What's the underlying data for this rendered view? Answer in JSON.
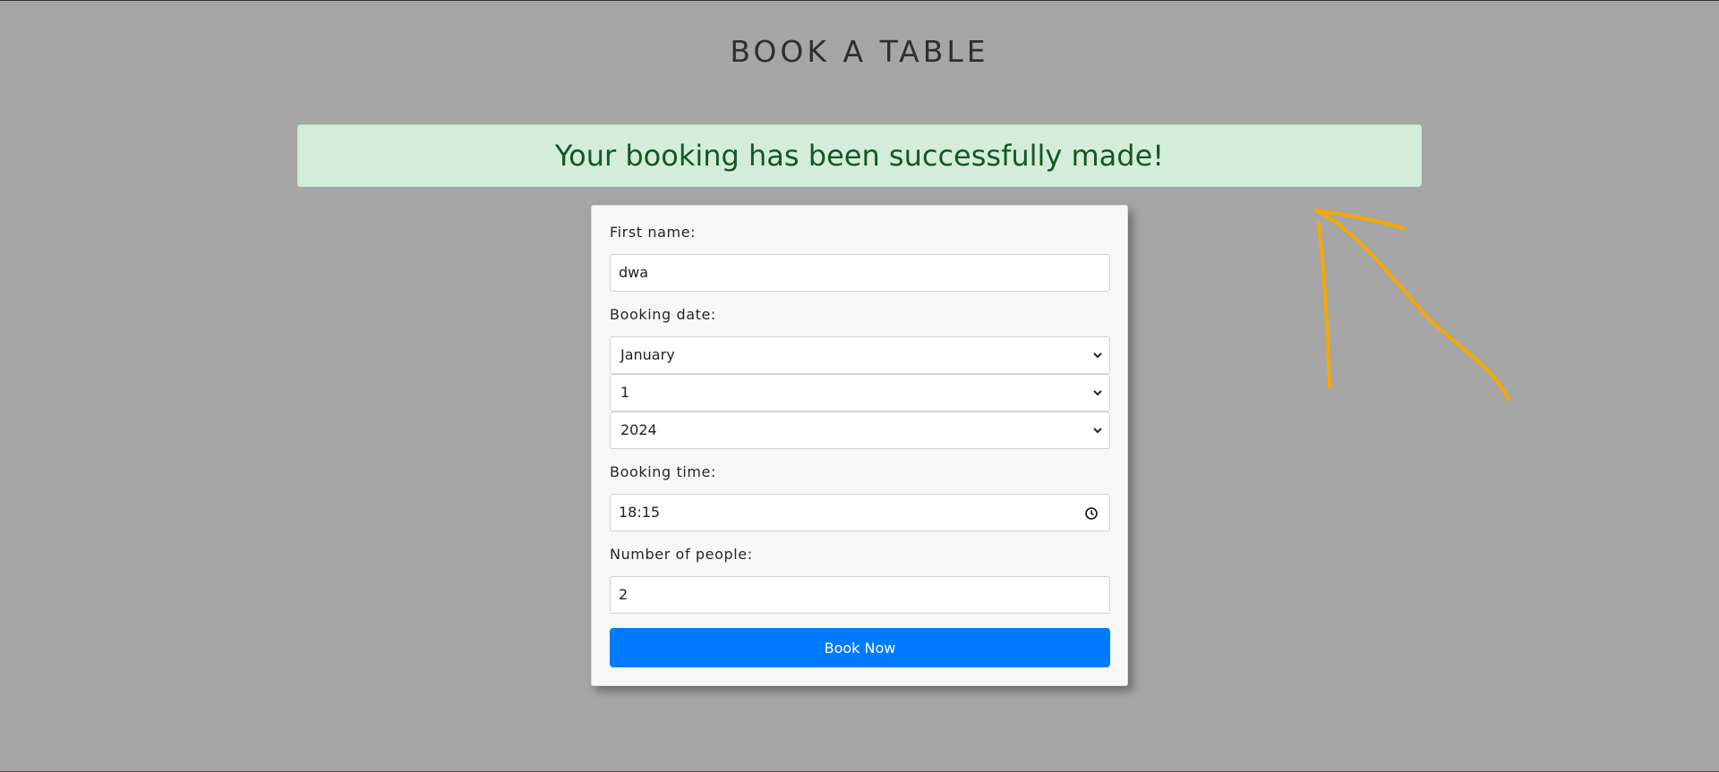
{
  "page": {
    "title": "BOOK A TABLE"
  },
  "alert": {
    "message": "Your booking has been successfully made!",
    "color": "#155724",
    "background": "#d4edda"
  },
  "form": {
    "first_name": {
      "label": "First name:",
      "value": "dwa"
    },
    "booking_date": {
      "label": "Booking date:",
      "month": "January",
      "day": "1",
      "year": "2024"
    },
    "booking_time": {
      "label": "Booking time:",
      "value": "18:15"
    },
    "people": {
      "label": "Number of people:",
      "value": "2"
    },
    "submit_label": "Book Now",
    "accent_color": "#007bff"
  },
  "icons": {
    "select_chevron": "chevron-down-icon",
    "time_picker": "clock-icon",
    "annotation": "arrow-annotation"
  },
  "annotation": {
    "color": "#f5a800"
  }
}
